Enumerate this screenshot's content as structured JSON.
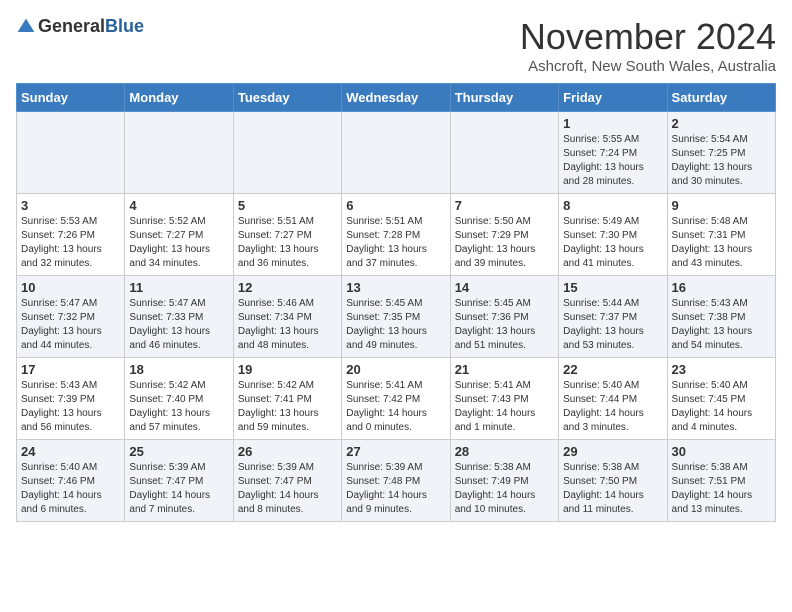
{
  "logo": {
    "general": "General",
    "blue": "Blue"
  },
  "title": "November 2024",
  "location": "Ashcroft, New South Wales, Australia",
  "weekdays": [
    "Sunday",
    "Monday",
    "Tuesday",
    "Wednesday",
    "Thursday",
    "Friday",
    "Saturday"
  ],
  "weeks": [
    [
      {
        "day": "",
        "info": ""
      },
      {
        "day": "",
        "info": ""
      },
      {
        "day": "",
        "info": ""
      },
      {
        "day": "",
        "info": ""
      },
      {
        "day": "",
        "info": ""
      },
      {
        "day": "1",
        "info": "Sunrise: 5:55 AM\nSunset: 7:24 PM\nDaylight: 13 hours\nand 28 minutes."
      },
      {
        "day": "2",
        "info": "Sunrise: 5:54 AM\nSunset: 7:25 PM\nDaylight: 13 hours\nand 30 minutes."
      }
    ],
    [
      {
        "day": "3",
        "info": "Sunrise: 5:53 AM\nSunset: 7:26 PM\nDaylight: 13 hours\nand 32 minutes."
      },
      {
        "day": "4",
        "info": "Sunrise: 5:52 AM\nSunset: 7:27 PM\nDaylight: 13 hours\nand 34 minutes."
      },
      {
        "day": "5",
        "info": "Sunrise: 5:51 AM\nSunset: 7:27 PM\nDaylight: 13 hours\nand 36 minutes."
      },
      {
        "day": "6",
        "info": "Sunrise: 5:51 AM\nSunset: 7:28 PM\nDaylight: 13 hours\nand 37 minutes."
      },
      {
        "day": "7",
        "info": "Sunrise: 5:50 AM\nSunset: 7:29 PM\nDaylight: 13 hours\nand 39 minutes."
      },
      {
        "day": "8",
        "info": "Sunrise: 5:49 AM\nSunset: 7:30 PM\nDaylight: 13 hours\nand 41 minutes."
      },
      {
        "day": "9",
        "info": "Sunrise: 5:48 AM\nSunset: 7:31 PM\nDaylight: 13 hours\nand 43 minutes."
      }
    ],
    [
      {
        "day": "10",
        "info": "Sunrise: 5:47 AM\nSunset: 7:32 PM\nDaylight: 13 hours\nand 44 minutes."
      },
      {
        "day": "11",
        "info": "Sunrise: 5:47 AM\nSunset: 7:33 PM\nDaylight: 13 hours\nand 46 minutes."
      },
      {
        "day": "12",
        "info": "Sunrise: 5:46 AM\nSunset: 7:34 PM\nDaylight: 13 hours\nand 48 minutes."
      },
      {
        "day": "13",
        "info": "Sunrise: 5:45 AM\nSunset: 7:35 PM\nDaylight: 13 hours\nand 49 minutes."
      },
      {
        "day": "14",
        "info": "Sunrise: 5:45 AM\nSunset: 7:36 PM\nDaylight: 13 hours\nand 51 minutes."
      },
      {
        "day": "15",
        "info": "Sunrise: 5:44 AM\nSunset: 7:37 PM\nDaylight: 13 hours\nand 53 minutes."
      },
      {
        "day": "16",
        "info": "Sunrise: 5:43 AM\nSunset: 7:38 PM\nDaylight: 13 hours\nand 54 minutes."
      }
    ],
    [
      {
        "day": "17",
        "info": "Sunrise: 5:43 AM\nSunset: 7:39 PM\nDaylight: 13 hours\nand 56 minutes."
      },
      {
        "day": "18",
        "info": "Sunrise: 5:42 AM\nSunset: 7:40 PM\nDaylight: 13 hours\nand 57 minutes."
      },
      {
        "day": "19",
        "info": "Sunrise: 5:42 AM\nSunset: 7:41 PM\nDaylight: 13 hours\nand 59 minutes."
      },
      {
        "day": "20",
        "info": "Sunrise: 5:41 AM\nSunset: 7:42 PM\nDaylight: 14 hours\nand 0 minutes."
      },
      {
        "day": "21",
        "info": "Sunrise: 5:41 AM\nSunset: 7:43 PM\nDaylight: 14 hours\nand 1 minute."
      },
      {
        "day": "22",
        "info": "Sunrise: 5:40 AM\nSunset: 7:44 PM\nDaylight: 14 hours\nand 3 minutes."
      },
      {
        "day": "23",
        "info": "Sunrise: 5:40 AM\nSunset: 7:45 PM\nDaylight: 14 hours\nand 4 minutes."
      }
    ],
    [
      {
        "day": "24",
        "info": "Sunrise: 5:40 AM\nSunset: 7:46 PM\nDaylight: 14 hours\nand 6 minutes."
      },
      {
        "day": "25",
        "info": "Sunrise: 5:39 AM\nSunset: 7:47 PM\nDaylight: 14 hours\nand 7 minutes."
      },
      {
        "day": "26",
        "info": "Sunrise: 5:39 AM\nSunset: 7:47 PM\nDaylight: 14 hours\nand 8 minutes."
      },
      {
        "day": "27",
        "info": "Sunrise: 5:39 AM\nSunset: 7:48 PM\nDaylight: 14 hours\nand 9 minutes."
      },
      {
        "day": "28",
        "info": "Sunrise: 5:38 AM\nSunset: 7:49 PM\nDaylight: 14 hours\nand 10 minutes."
      },
      {
        "day": "29",
        "info": "Sunrise: 5:38 AM\nSunset: 7:50 PM\nDaylight: 14 hours\nand 11 minutes."
      },
      {
        "day": "30",
        "info": "Sunrise: 5:38 AM\nSunset: 7:51 PM\nDaylight: 14 hours\nand 13 minutes."
      }
    ]
  ]
}
